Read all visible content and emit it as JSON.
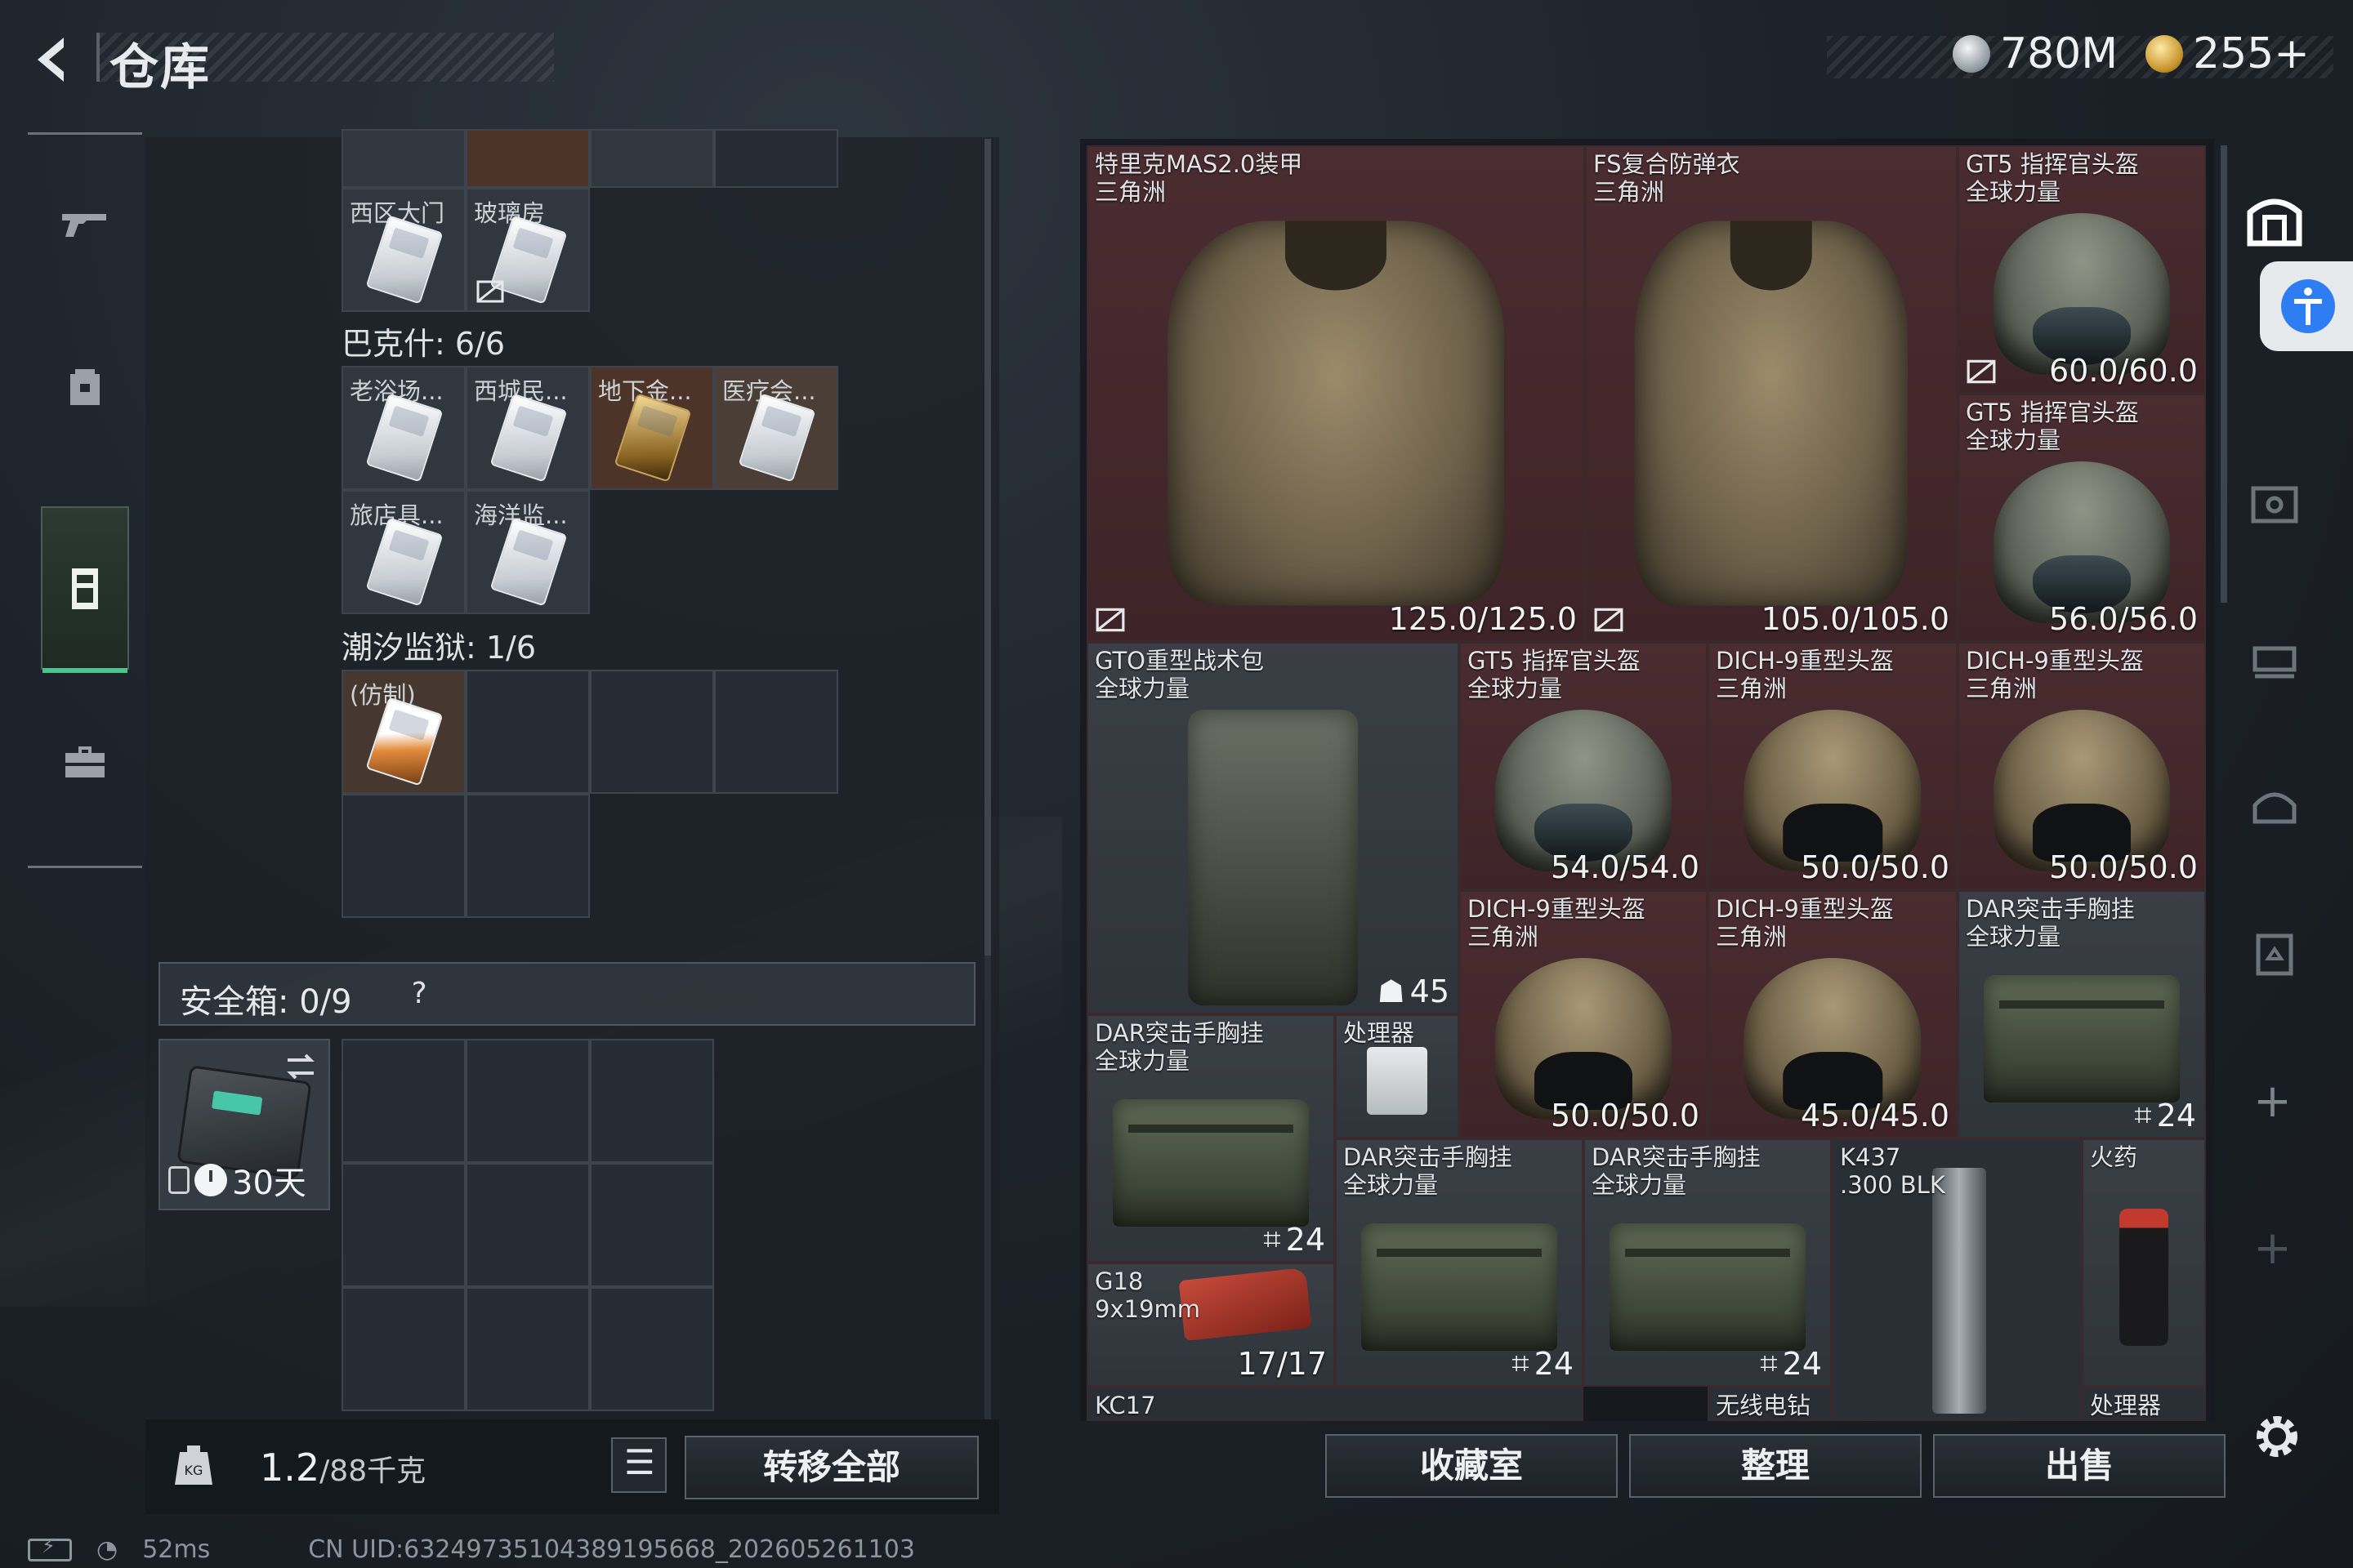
{
  "header": {
    "title": "仓库",
    "back_icon": "back-arrow-icon"
  },
  "currency": {
    "silver": "780M",
    "gold": "255+"
  },
  "nav": [
    {
      "name": "weapons",
      "icon": "gun-icon",
      "active": false
    },
    {
      "name": "backpack",
      "icon": "backpack-icon",
      "active": false
    },
    {
      "name": "storage",
      "icon": "locker-icon",
      "active": true
    },
    {
      "name": "toolbox",
      "icon": "toolbox-icon",
      "active": false
    }
  ],
  "storage": {
    "top_row_labels": [
      "西区大门",
      "玻璃房"
    ],
    "group1_label": "巴克什: 6/6",
    "group1_cells": [
      "老浴场...",
      "西城民...",
      "地下金...",
      "医疗会...",
      "旅店具...",
      "海洋监..."
    ],
    "group2_label": "潮汐监狱: 1/6",
    "group2_cells": [
      "(仿制)"
    ]
  },
  "safebox": {
    "label": "安全箱: 0/9",
    "help": "?",
    "timer": "30天"
  },
  "footer_left": {
    "weight": "1.2",
    "capacity": "/88千克",
    "transfer_all": "转移全部"
  },
  "inventory": {
    "items": [
      {
        "name": "特里克MAS2.0装甲\n三角洲",
        "dur": "125.0/125.0"
      },
      {
        "name": "FS复合防弹衣\n三角洲",
        "dur": "105.0/105.0"
      },
      {
        "name": "GT5 指挥官头盔\n全球力量",
        "dur": "60.0/60.0"
      },
      {
        "name": "GT5 指挥官头盔\n全球力量",
        "dur": "56.0/56.0"
      },
      {
        "name": "GTO重型战术包\n全球力量",
        "count": "45"
      },
      {
        "name": "GT5 指挥官头盔\n全球力量",
        "dur": "54.0/54.0"
      },
      {
        "name": "DICH-9重型头盔\n三角洲",
        "dur": "50.0/50.0"
      },
      {
        "name": "DICH-9重型头盔\n三角洲",
        "dur": "50.0/50.0"
      },
      {
        "name": "DICH-9重型头盔\n三角洲",
        "dur": "50.0/50.0"
      },
      {
        "name": "DICH-9重型头盔\n三角洲",
        "dur": "45.0/45.0"
      },
      {
        "name": "DAR突击手胸挂\n全球力量",
        "count": "24"
      },
      {
        "name": "DAR突击手胸挂\n全球力量",
        "count": "24"
      },
      {
        "name": "处理器"
      },
      {
        "name": "DAR突击手胸挂\n全球力量",
        "count": "24"
      },
      {
        "name": "DAR突击手胸挂\n全球力量",
        "count": "24"
      },
      {
        "name": "K437\n.300 BLK"
      },
      {
        "name": "火药"
      },
      {
        "name": "G18\n9x19mm",
        "dur": "17/17"
      },
      {
        "name": "KC17"
      },
      {
        "name": "无线电钻"
      },
      {
        "name": "处理器"
      }
    ]
  },
  "footer_right": {
    "collection": "收藏室",
    "organize": "整理",
    "sell": "出售"
  },
  "status": {
    "ping": "52ms",
    "uid": "CN UID:6324973510438919566​8_202605261103"
  }
}
